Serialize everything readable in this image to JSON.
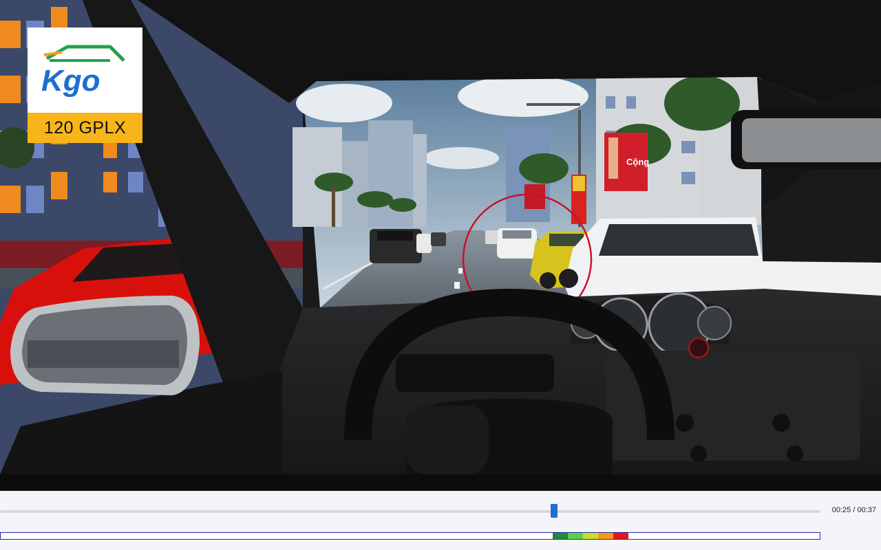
{
  "overlay": {
    "brand_logo_text": "Kgo",
    "caption": "120 GPLX"
  },
  "scene": {
    "billboard_text": "Cộng"
  },
  "player": {
    "time_display": "00:25 / 00:37",
    "current_seconds": 25,
    "total_seconds": 37,
    "score_zones": [
      {
        "color": "#1f8a3a"
      },
      {
        "color": "#5ccf4d"
      },
      {
        "color": "#c9dd2b"
      },
      {
        "color": "#f39a1d"
      },
      {
        "color": "#e21919"
      }
    ]
  },
  "colors": {
    "seek_handle": "#1f6fd1",
    "score_bar_border": "#2a23a8",
    "highlight_circle": "#c8102e",
    "logo_band": "#f7b51a"
  }
}
